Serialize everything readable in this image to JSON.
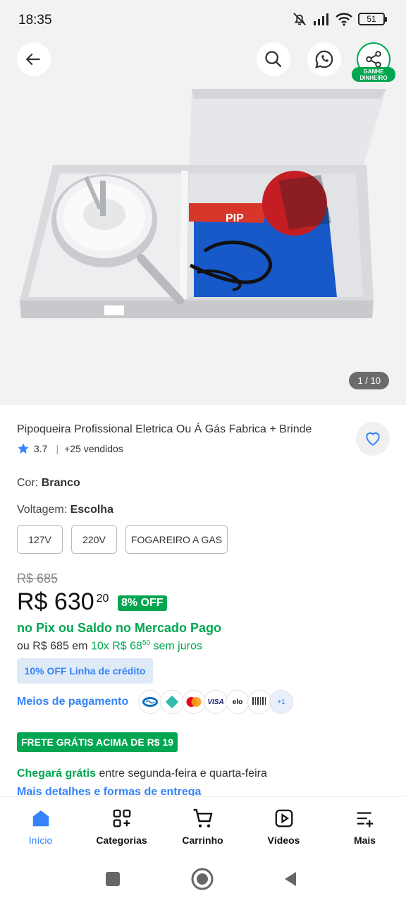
{
  "status_bar": {
    "time": "18:35",
    "battery": "51"
  },
  "hero": {
    "earn_badge_line1": "GANHE",
    "earn_badge_line2": "DINHEIRO",
    "image_counter": "1 / 10"
  },
  "product": {
    "title": "Pipoqueira Profissional Eletrica Ou Á Gás Fabrica + Brinde",
    "rating": "3.7",
    "sold": "+25 vendidos",
    "color_label": "Cor:",
    "color_value": "Branco",
    "voltage_label": "Voltagem:",
    "voltage_value": "Escolha",
    "voltage_options": [
      "127V",
      "220V",
      "FOGAREIRO A GAS"
    ]
  },
  "pricing": {
    "old_price": "R$ 685",
    "price_main": "R$ 630",
    "price_cents": "20",
    "discount": "8% OFF",
    "pix_text": "no Pix ou Saldo no Mercado Pago",
    "install_prefix": "ou R$ 685  em",
    "install_count": "10x R$ 68",
    "install_cents": "50",
    "install_suffix": "sem juros",
    "credit_tag": "10% OFF Linha de crédito",
    "payment_label": "Meios de pagamento",
    "payment_icons": [
      "mercado-pago-icon",
      "pix-icon",
      "mastercard-icon",
      "visa-icon",
      "elo-icon",
      "boleto-icon"
    ],
    "visa_text": "VISA",
    "elo_text": "elo",
    "more_methods": "+1"
  },
  "shipping": {
    "free_banner": "FRETE GRÁTIS ACIMA DE R$ 19",
    "arrival_highlight": "Chegará grátis",
    "arrival_rest": " entre segunda-feira e quarta-feira",
    "more_details": "Mais detalhes e formas de entrega"
  },
  "bottom_nav": [
    {
      "label": "Início",
      "icon": "home-icon",
      "active": true
    },
    {
      "label": "Categorias",
      "icon": "categories-icon"
    },
    {
      "label": "Carrinho",
      "icon": "cart-icon"
    },
    {
      "label": "Vídeos",
      "icon": "video-icon"
    },
    {
      "label": "Mais",
      "icon": "menu-plus-icon"
    }
  ],
  "colors": {
    "brand_blue": "#3483fa",
    "brand_green": "#00a650"
  }
}
